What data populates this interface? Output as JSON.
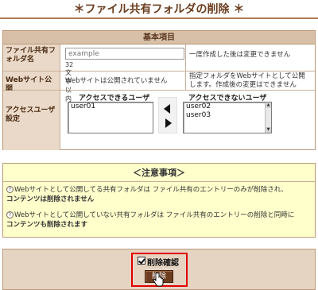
{
  "page": {
    "title": "＊ファイル共有フォルダの削除 ＊"
  },
  "settings": {
    "section_title": "基本項目",
    "folder_name": {
      "label": "ファイル共有フォルダ名",
      "placeholder": "example",
      "hint": "32文字以内",
      "note": "一度作成した後は変更できません"
    },
    "web_publish": {
      "label": "Webサイト公開",
      "value": "Webサイトは公開されていません",
      "note": "指定フォルダをWebサイトとして公開します。作成後の変更はできません"
    },
    "access_users": {
      "label": "アクセスユーザ設定",
      "allowed_title": "アクセスできるユーザ",
      "denied_title": "アクセスできないユーザ",
      "allowed": [
        "user01"
      ],
      "denied": [
        "user02",
        "user03"
      ]
    }
  },
  "notice": {
    "title": "＜注意事項＞",
    "items": [
      {
        "text": "Webサイトとして公開してる共有フォルダは ファイル共有のエントリーのみが削除され、",
        "bold": "コンテンツは削除されません"
      },
      {
        "text": "Webサイトとして公開していない共有フォルダは ファイル共有のエントリーの削除と同時に",
        "bold": "コンテンツも削除されます"
      }
    ]
  },
  "action": {
    "confirm_label": "削除確認",
    "confirm_checked": true,
    "delete_label": "削除"
  }
}
